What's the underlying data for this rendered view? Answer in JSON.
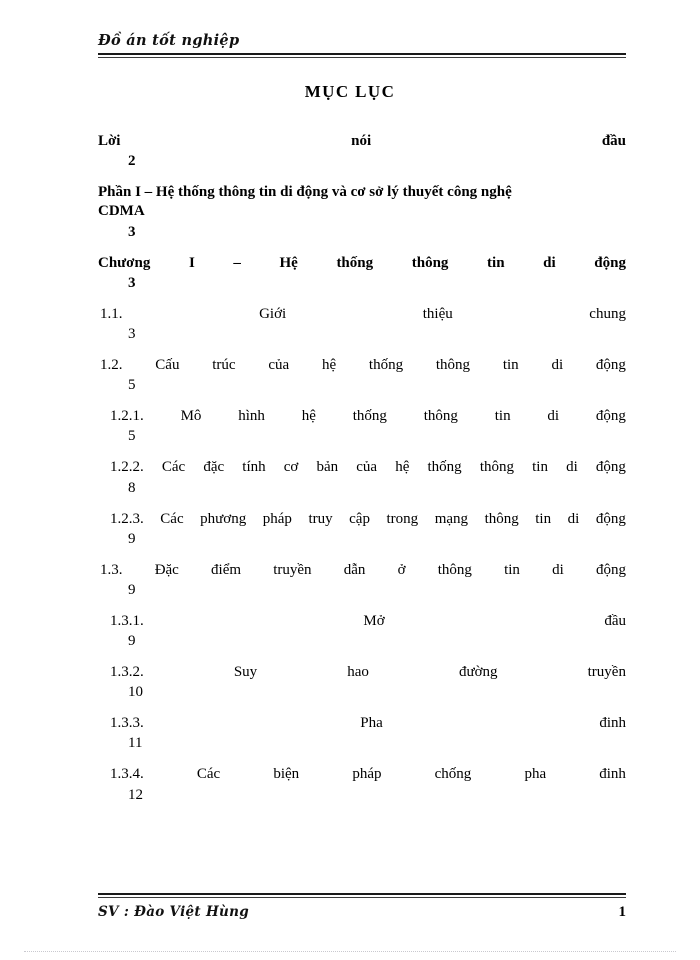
{
  "header": {
    "running_title": "Đồ án tốt nghiệp"
  },
  "title": "MỤC LỤC",
  "toc": {
    "entries": [
      {
        "words": [
          "Lời",
          "nói",
          "đầu"
        ],
        "text": "Lời nói đầu",
        "page": "2",
        "bold": true,
        "level": 0,
        "layout": "spread"
      },
      {
        "words": [
          "Phần I – Hệ thống thông tin di động và cơ sở lý thuyết công nghệ",
          "CDMA"
        ],
        "text": "Phần I – Hệ thống thông tin di động và cơ sở lý thuyết công nghệ CDMA",
        "page": "3",
        "bold": true,
        "level": 0,
        "layout": "flow"
      },
      {
        "words": [
          "Chương",
          "I",
          "–",
          "Hệ",
          "thống",
          "thông",
          "tin",
          "di",
          "động"
        ],
        "text": "Chương I – Hệ thống thông tin di động",
        "page": "3",
        "bold": true,
        "level": 0,
        "layout": "spread"
      },
      {
        "words": [
          "1.1.",
          "Giới",
          "thiệu",
          "chung"
        ],
        "text": "1.1. Giới thiệu chung",
        "page": "3",
        "bold": false,
        "level": 1,
        "layout": "spread"
      },
      {
        "words": [
          "1.2.",
          "Cấu",
          "trúc",
          "của",
          "hệ",
          "thống",
          "thông",
          "tin",
          "di",
          "động"
        ],
        "text": "1.2. Cấu trúc của hệ thống thông tin di động",
        "page": "5",
        "bold": false,
        "level": 1,
        "layout": "spread"
      },
      {
        "words": [
          "1.2.1.",
          "Mô",
          "hình",
          "hệ",
          "thống",
          "thông",
          "tin",
          "di",
          "động"
        ],
        "text": "1.2.1. Mô hình hệ thống thông tin di động",
        "page": "5",
        "bold": false,
        "level": 2,
        "layout": "spread"
      },
      {
        "words": [
          "1.2.2.",
          "Các",
          "đặc",
          "tính",
          "cơ",
          "bản",
          "của",
          "hệ",
          "thống",
          "thông",
          "tin",
          "di",
          "động"
        ],
        "text": "1.2.2. Các đặc tính cơ bản của hệ thống thông tin di động",
        "page": "8",
        "bold": false,
        "level": 2,
        "layout": "spread"
      },
      {
        "words": [
          "1.2.3.",
          "Các",
          "phương",
          "pháp",
          "truy",
          "cập",
          "trong",
          "mạng",
          "thông",
          "tin",
          "di",
          "động"
        ],
        "text": "1.2.3. Các phương pháp truy cập trong mạng thông tin di động",
        "page": "9",
        "bold": false,
        "level": 2,
        "layout": "spread"
      },
      {
        "words": [
          "1.3.",
          "Đặc",
          "điểm",
          "truyền",
          "dẫn",
          "ở",
          "thông",
          "tin",
          "di",
          "động"
        ],
        "text": "1.3. Đặc điểm truyền dẫn ở thông tin di động",
        "page": "9",
        "bold": false,
        "level": 1,
        "layout": "spread"
      },
      {
        "words": [
          "1.3.1.",
          "Mở",
          "đầu"
        ],
        "text": "1.3.1. Mở đầu",
        "page": "9",
        "bold": false,
        "level": 2,
        "layout": "spread"
      },
      {
        "words": [
          "1.3.2.",
          "Suy",
          "hao",
          "đường",
          "truyền"
        ],
        "text": "1.3.2. Suy hao đường truyền",
        "page": "10",
        "bold": false,
        "level": 2,
        "layout": "spread"
      },
      {
        "words": [
          "1.3.3.",
          "Pha",
          "đinh"
        ],
        "text": "1.3.3. Pha đinh",
        "page": "11",
        "bold": false,
        "level": 2,
        "layout": "spread"
      },
      {
        "words": [
          "1.3.4.",
          "Các",
          "biện",
          "pháp",
          "chống",
          "pha",
          "đinh"
        ],
        "text": "1.3.4. Các biện pháp chống pha đinh",
        "page": "12",
        "bold": false,
        "level": 2,
        "layout": "spread"
      }
    ]
  },
  "footer": {
    "author": "SV : Đào Việt Hùng",
    "page_number": "1"
  }
}
